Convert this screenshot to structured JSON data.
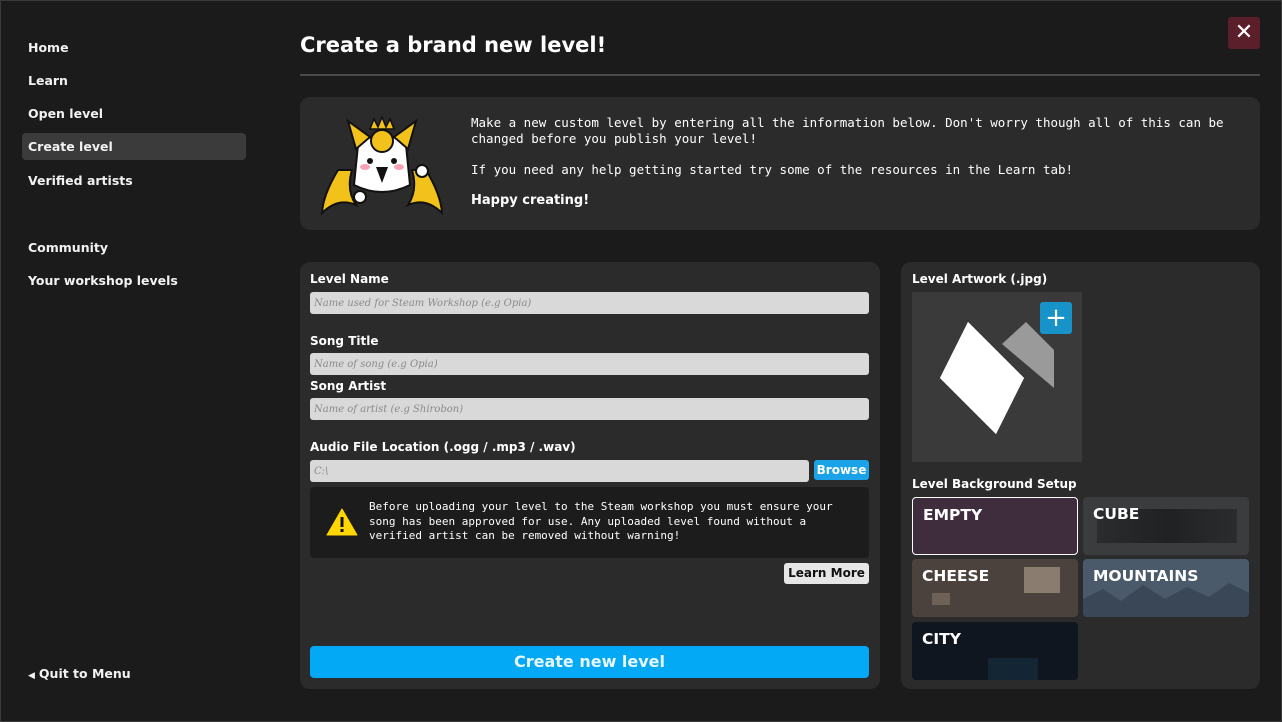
{
  "sidebar": {
    "items": [
      {
        "label": "Home"
      },
      {
        "label": "Learn"
      },
      {
        "label": "Open level"
      },
      {
        "label": "Create level"
      },
      {
        "label": "Verified artists"
      },
      {
        "label": "Community"
      },
      {
        "label": "Your workshop levels"
      }
    ],
    "active": "Create level",
    "quit_label": "Quit to Menu",
    "quit_icon": "triangle-left-icon"
  },
  "header": {
    "title": "Create a brand new level!",
    "close_icon": "close-icon"
  },
  "intro": {
    "paragraph1": "Make a new custom level by entering all the information below. Don't worry though all of this can be changed before you publish your level!",
    "paragraph2": "If you need any help getting started try some of the resources in the Learn tab!",
    "closing": "Happy creating!"
  },
  "form": {
    "level_name": {
      "label": "Level Name",
      "placeholder": "Name used for Steam Workshop (e.g Opia)",
      "value": ""
    },
    "song_title": {
      "label": "Song Title",
      "placeholder": "Name of song (e.g Opia)",
      "value": ""
    },
    "song_artist": {
      "label": "Song Artist",
      "placeholder": "Name of artist (e.g Shirobon)",
      "value": ""
    },
    "audio_file": {
      "label": "Audio File Location (.ogg / .mp3 / .wav)",
      "placeholder": "C:\\",
      "value": ""
    },
    "browse_label": "Browse",
    "warning": "Before uploading your level to the Steam workshop you must ensure your song has been approved for use. Any uploaded level found without a verified artist can be removed without warning!",
    "learn_more_label": "Learn More",
    "create_label": "Create new level"
  },
  "artwork": {
    "label": "Level Artwork (.jpg)",
    "add_icon": "plus-icon"
  },
  "background": {
    "label": "Level Background Setup",
    "options": [
      {
        "label": "EMPTY",
        "color": "#3f2d3e"
      },
      {
        "label": "CUBE",
        "color": "#343638"
      },
      {
        "label": "CHEESE",
        "color": "#4c423d"
      },
      {
        "label": "MOUNTAINS",
        "color": "#4a5a6a"
      },
      {
        "label": "CITY",
        "color": "#0f1620"
      }
    ],
    "selected": "EMPTY"
  },
  "colors": {
    "accent": "#03a9f4",
    "close": "#5a1f2b",
    "panel": "#2b2b2b",
    "background": "#1b1b1b",
    "warning": "#ffd600"
  }
}
